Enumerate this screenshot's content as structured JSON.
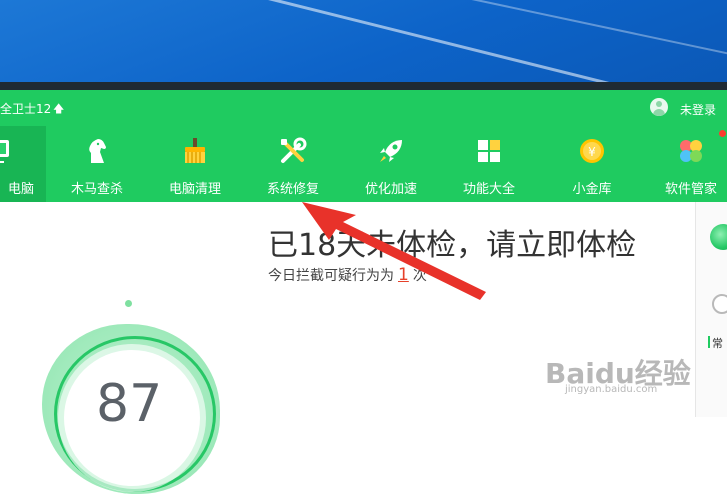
{
  "window": {
    "title": "全卫士12",
    "login_text": "未登录"
  },
  "nav": {
    "items": [
      {
        "label": "电脑",
        "icon": "monitor-icon",
        "active": true
      },
      {
        "label": "木马查杀",
        "icon": "horse-icon"
      },
      {
        "label": "电脑清理",
        "icon": "broom-icon"
      },
      {
        "label": "系统修复",
        "icon": "tools-icon"
      },
      {
        "label": "优化加速",
        "icon": "rocket-icon"
      },
      {
        "label": "功能大全",
        "icon": "grid-icon"
      },
      {
        "label": "小金库",
        "icon": "coin-icon"
      },
      {
        "label": "软件管家",
        "icon": "apps-icon",
        "badge": true
      }
    ]
  },
  "main": {
    "score": "87",
    "headline": "已18天未体检，请立即体检",
    "sub_prefix": "今日拦截可疑行为为",
    "sub_count": "1",
    "sub_suffix": "次"
  },
  "side_panel": {
    "label": "常"
  },
  "watermark": {
    "text": "Baidu经验",
    "url": "jingyan.baidu.com"
  },
  "colors": {
    "brand_green": "#1fcb60",
    "active_green": "#18b554",
    "count_red": "#e6412a",
    "arrow_red": "#e8322a"
  }
}
